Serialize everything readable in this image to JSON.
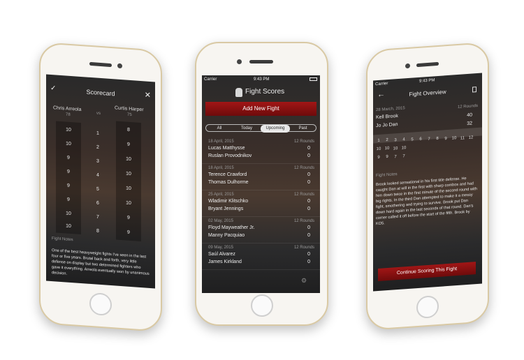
{
  "status": {
    "carrier": "Carrier",
    "time": "9:43 PM"
  },
  "scorecard": {
    "title": "Scorecard",
    "fighter1": {
      "name": "Chris Arreola",
      "total": "78"
    },
    "vs": "vs",
    "fighter2": {
      "name": "Curtis Harper",
      "total": "75"
    },
    "scores1": [
      "10",
      "10",
      "9",
      "9",
      "9",
      "9",
      "10",
      "10"
    ],
    "rounds": [
      "1",
      "2",
      "3",
      "4",
      "5",
      "6",
      "7",
      "8"
    ],
    "scores2": [
      "8",
      "9",
      "10",
      "10",
      "10",
      "10",
      "9",
      "9"
    ],
    "notes_label": "Fight Notes",
    "notes": "One of the best heavyweight fights I've seen in the last four or five years. Brutal back and forth, very little defense on display but two determined fighters who gave it everything. Arreola eventually won by unanimous decision."
  },
  "scores": {
    "title": "Fight Scores",
    "add_button": "Add New Fight",
    "tabs": [
      "All",
      "Today",
      "Upcoming",
      "Past"
    ],
    "selected_tab": "Upcoming",
    "fights": [
      {
        "date": "18 April, 2015",
        "rounds": "12 Rounds",
        "f1": "Lucas Matthysse",
        "s1": "0",
        "f2": "Ruslan Provodnikov",
        "s2": "0"
      },
      {
        "date": "18 April, 2015",
        "rounds": "12 Rounds",
        "f1": "Terence Crawford",
        "s1": "0",
        "f2": "Thomas Dulhorme",
        "s2": "0"
      },
      {
        "date": "25 April, 2015",
        "rounds": "12 Rounds",
        "f1": "Wladimir Klitschko",
        "s1": "0",
        "f2": "Bryant Jennings",
        "s2": "0"
      },
      {
        "date": "02 May, 2015",
        "rounds": "12 Rounds",
        "f1": "Floyd Mayweather Jr.",
        "s1": "0",
        "f2": "Manny Pacquiao",
        "s2": "0"
      },
      {
        "date": "09 May, 2015",
        "rounds": "12 Rounds",
        "f1": "Saúl Alvarez",
        "s1": "0",
        "f2": "James Kirkland",
        "s2": "0"
      }
    ]
  },
  "overview": {
    "title": "Fight Overview",
    "date": "28 March, 2015",
    "rounds_label": "12 Rounds",
    "fighter1": {
      "name": "Kell Brook",
      "total": "40"
    },
    "fighter2": {
      "name": "Jo Jo Dan",
      "total": "32"
    },
    "round_numbers": [
      "1",
      "2",
      "3",
      "4",
      "5",
      "6",
      "7",
      "8",
      "9",
      "10",
      "11",
      "12"
    ],
    "row1": [
      "10",
      "10",
      "10",
      "10",
      "",
      "",
      "",
      "",
      "",
      "",
      "",
      ""
    ],
    "row2": [
      "9",
      "9",
      "7",
      "7",
      "",
      "",
      "",
      "",
      "",
      "",
      "",
      ""
    ],
    "notes_label": "Fight Notes",
    "notes": "Brook looked sensational in his first title defense. He caught Dan at will in the first with sharp combos and had him down twice in the first minute of the second round with big rights. In the third Dan attempted to make it a messy fight, smothering and trying to survive. Brook put Dan down hard again in the last seconds of that round. Dan's corner called it off before the start of the fifth. Brook by KO5.",
    "continue_button": "Continue Scoring This Fight"
  }
}
